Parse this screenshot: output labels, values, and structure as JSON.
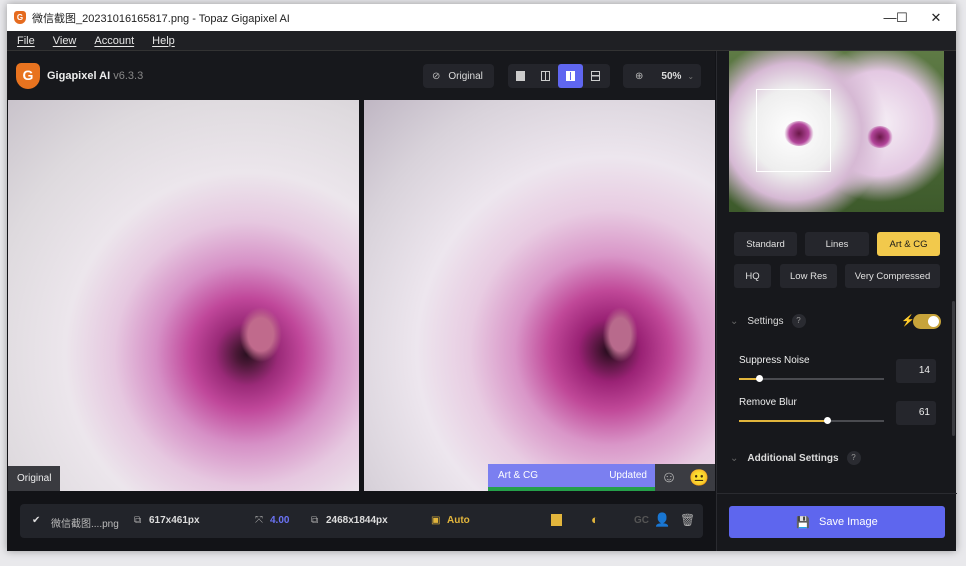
{
  "window": {
    "title": "微信截图_20231016165817.png - Topaz Gigapixel AI",
    "minimize": "—",
    "maximize": "☐",
    "close": "✕"
  },
  "menu": [
    "File",
    "View",
    "Account",
    "Help"
  ],
  "brand": {
    "name": "Gigapixel AI",
    "version": "v6.3.3",
    "logo": "G"
  },
  "toolbar": {
    "original_label": "Original",
    "zoom": "50%",
    "view_modes": [
      "single-view",
      "split-view",
      "side-by-side-view",
      "grid-view"
    ],
    "active_view": "side-by-side-view"
  },
  "preview": {
    "original_label": "Original",
    "model_label": "Art & CG",
    "status": "Updated",
    "accent": "#7b7ff0",
    "progress": 1.0
  },
  "bottom": {
    "file": "微信截图....png",
    "input_size": "617x461px",
    "scale": "4.00",
    "output_size": "2468x1844px",
    "auto_label": "Auto",
    "gc_label": "GC"
  },
  "models": {
    "row1": [
      "Standard",
      "Lines",
      "Art & CG"
    ],
    "row2": [
      "HQ",
      "Low Res",
      "Very Compressed"
    ],
    "selected": "Art & CG"
  },
  "settings": {
    "title": "Settings",
    "help": "?",
    "auto_toggle": true,
    "suppress_noise": {
      "label": "Suppress Noise",
      "value": "14",
      "fraction": 0.14
    },
    "remove_blur": {
      "label": "Remove Blur",
      "value": "61",
      "fraction": 0.61
    },
    "additional": "Additional Settings"
  },
  "save_label": "Save Image",
  "colors": {
    "accent": "#5e66ee",
    "selected": "#f2c94c"
  }
}
